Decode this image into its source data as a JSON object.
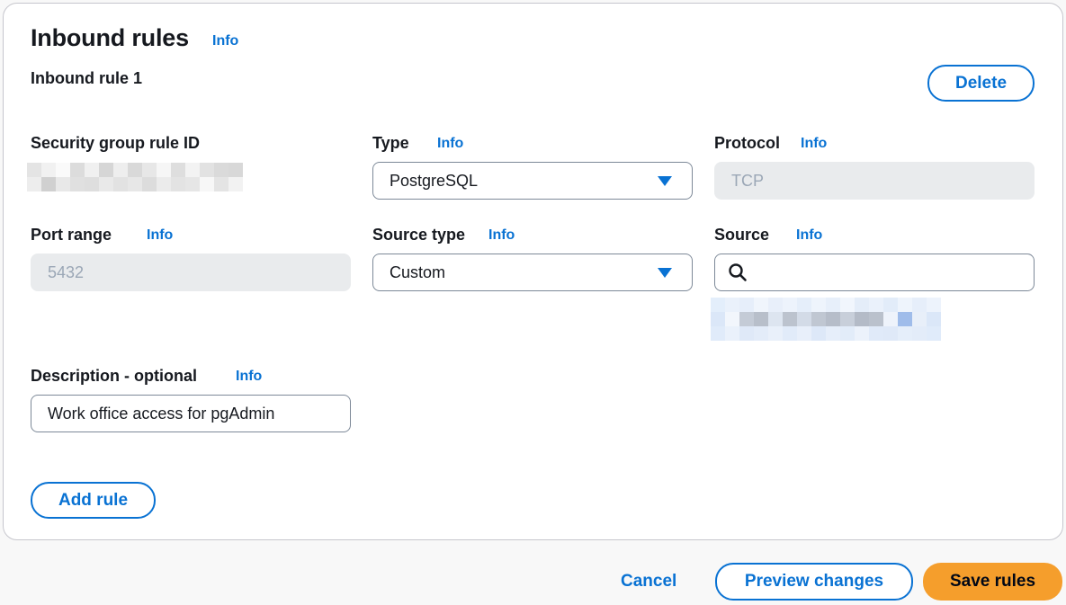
{
  "panel": {
    "title": "Inbound rules",
    "title_info": "Info",
    "rule_heading": "Inbound rule 1",
    "delete_label": "Delete"
  },
  "fields": {
    "sg_rule_id": {
      "label": "Security group rule ID"
    },
    "type": {
      "label": "Type",
      "info": "Info",
      "value": "PostgreSQL"
    },
    "protocol": {
      "label": "Protocol",
      "info": "Info",
      "value": "TCP"
    },
    "port_range": {
      "label": "Port range",
      "info": "Info",
      "value": "5432"
    },
    "source_type": {
      "label": "Source type",
      "info": "Info",
      "value": "Custom"
    },
    "source": {
      "label": "Source",
      "info": "Info",
      "value": ""
    },
    "description": {
      "label": "Description - optional",
      "info": "Info",
      "value": "Work office access for pgAdmin"
    }
  },
  "add_rule_label": "Add rule",
  "footer": {
    "cancel_label": "Cancel",
    "preview_label": "Preview changes",
    "save_label": "Save rules"
  },
  "icons": {
    "search": "search-icon",
    "caret": "caret-down-icon"
  },
  "colors": {
    "accent": "#0972d3",
    "primary_button": "#f59e2c",
    "disabled_field": "#e9ebed"
  }
}
